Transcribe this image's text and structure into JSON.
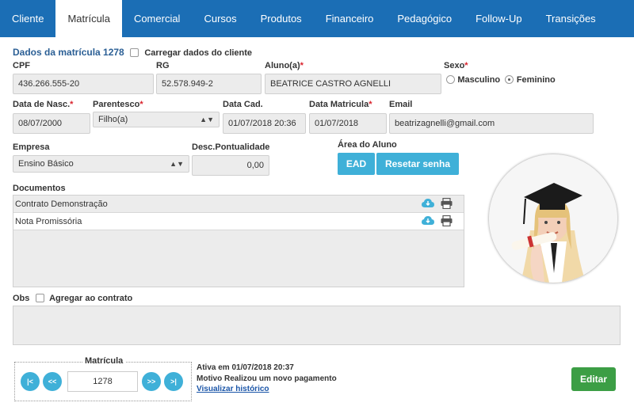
{
  "tabs": [
    {
      "label": "Cliente"
    },
    {
      "label": "Matrícula"
    },
    {
      "label": "Comercial"
    },
    {
      "label": "Cursos"
    },
    {
      "label": "Produtos"
    },
    {
      "label": "Financeiro"
    },
    {
      "label": "Pedagógico"
    },
    {
      "label": "Follow-Up"
    },
    {
      "label": "Transições"
    }
  ],
  "active_tab": "Matrícula",
  "form": {
    "section_title": "Dados da matrícula 1278",
    "load_client_label": "Carregar dados do cliente",
    "cpf": {
      "label": "CPF",
      "value": "436.266.555-20"
    },
    "rg": {
      "label": "RG",
      "value": "52.578.949-2"
    },
    "aluno": {
      "label": "Aluno(a)",
      "value": "BEATRICE CASTRO AGNELLI"
    },
    "sexo": {
      "label": "Sexo",
      "options": [
        "Masculino",
        "Feminino"
      ],
      "selected": "Feminino"
    },
    "data_nasc": {
      "label": "Data de Nasc.",
      "value": "08/07/2000"
    },
    "parentesco": {
      "label": "Parentesco",
      "value": "Filho(a)"
    },
    "data_cad": {
      "label": "Data Cad.",
      "value": "01/07/2018 20:36"
    },
    "data_matricula": {
      "label": "Data Matricula",
      "value": "01/07/2018"
    },
    "email": {
      "label": "Email",
      "value": "beatrizagnelli@gmail.com"
    },
    "empresa": {
      "label": "Empresa",
      "value": "Ensino Básico"
    },
    "desc_pontualidade": {
      "label": "Desc.Pontualidade",
      "value": "0,00"
    },
    "area_aluno": {
      "label": "Área do Aluno",
      "ead_label": "EAD",
      "reset_label": "Resetar senha"
    },
    "required_mark": "*"
  },
  "documents": {
    "label": "Documentos",
    "items": [
      {
        "name": "Contrato Demonstração"
      },
      {
        "name": "Nota Promissória"
      }
    ]
  },
  "obs": {
    "label": "Obs",
    "agregar_label": "Agregar ao contrato"
  },
  "navigator": {
    "legend": "Matrícula",
    "value": "1278",
    "first": "|<",
    "prev": "<<",
    "next": ">>",
    "last": ">|"
  },
  "status": {
    "line1": "Ativa em 01/07/2018 20:37",
    "line2": "Motivo Realizou um novo pagamento",
    "history_link": "Visualizar histórico"
  },
  "actions": {
    "edit_label": "Editar"
  },
  "colors": {
    "tabbar": "#1b6eb5",
    "accent": "#3fb0d8",
    "edit": "#3c9e45",
    "required": "#d9232d"
  }
}
